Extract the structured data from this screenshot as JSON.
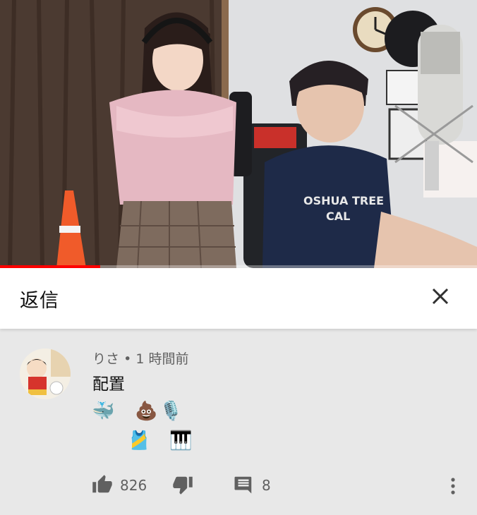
{
  "reply_panel": {
    "title": "返信",
    "close_icon": "close-icon"
  },
  "video": {
    "progress_fraction": 0.21,
    "colors": {
      "progress": "#ff0000"
    }
  },
  "comment": {
    "author": "りさ",
    "separator": "•",
    "time": "1 時間前",
    "text": "配置",
    "emoji_rows": [
      [
        "🐳",
        "💩",
        "🎙️"
      ],
      [
        "🎽",
        "🎹"
      ]
    ],
    "like_count": "826",
    "reply_count": "8",
    "icons": [
      "thumbs-up-icon",
      "thumbs-down-icon",
      "comment-icon",
      "more-vert-icon"
    ]
  }
}
